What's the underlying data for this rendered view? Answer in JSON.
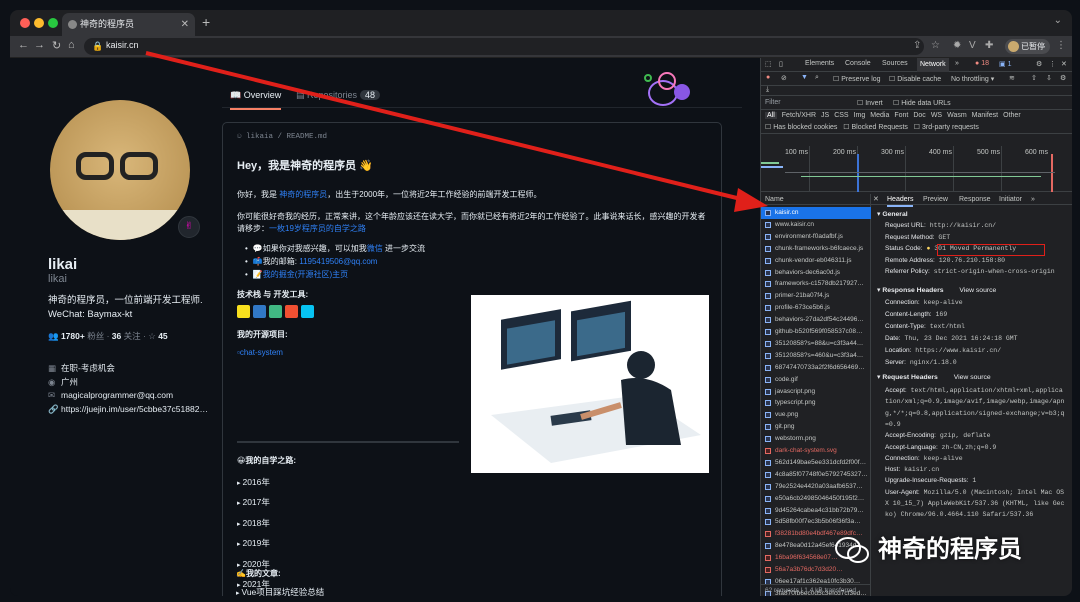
{
  "browser": {
    "tab_title": "神奇的程序员",
    "url": "kaisir.cn",
    "profile_label": "已暂停"
  },
  "profile": {
    "name": "likai",
    "login": "likai",
    "bio_line1": "神奇的程序员，一位前端开发工程师.",
    "bio_line2": "WeChat: Baymax-kt",
    "followers": "1780+",
    "followers_label": "粉丝",
    "following": "36",
    "following_label": "关注",
    "stars": "45",
    "company": "在职-考虑机会",
    "location": "广州",
    "email": "magicalprogrammer@qq.com",
    "website": "https://juejin.im/user/5cbbe37c51882…"
  },
  "tabs": {
    "overview": "Overview",
    "repositories": "Repositories",
    "repo_count": "48"
  },
  "readme": {
    "path": "likaia / README.md",
    "heading": "Hey，我是神奇的程序员 👋",
    "p1_a": "你好，我是",
    "p1_link": "神奇的程序员",
    "p1_b": "，出生于2000年，一位将近2年工作经验的前端开发工程师。",
    "p2": "你可能很好奇我的经历，正常来讲，这个年龄应该还在读大学，而你就已经有将近2年的工作经验了。此事说来话长，感兴趣的开发者请移步：",
    "p2_link": "一枚19岁程序员的自学之路",
    "li1_a": "💬如果你对我感兴趣，可以加我",
    "li1_link": "微信",
    "li1_b": "进一步交流",
    "li2_a": "📫我的邮箱: ",
    "li2_link": "1195419506@qq.com",
    "li3_link": "我的掘金(开源社区)主页",
    "tech_title": "技术栈 与 开发工具:",
    "opensource_title": "我的开源项目:",
    "img_alt": "chat-system",
    "selflearn_title": "😀我的自学之路:",
    "years": [
      "2016年",
      "2017年",
      "2018年",
      "2019年",
      "2020年",
      "2021年"
    ],
    "articles_title": "✍️我的文章:",
    "article1": "Vue项目踩坑经验总结"
  },
  "devtools": {
    "tabs": [
      "Elements",
      "Console",
      "Sources",
      "Network"
    ],
    "errors": "18",
    "messages": "1",
    "preserve_log": "Preserve log",
    "disable_cache": "Disable cache",
    "throttle": "No throttling",
    "filter_placeholder": "Filter",
    "invert": "Invert",
    "hide_data_urls": "Hide data URLs",
    "types": [
      "All",
      "Fetch/XHR",
      "JS",
      "CSS",
      "Img",
      "Media",
      "Font",
      "Doc",
      "WS",
      "Wasm",
      "Manifest",
      "Other"
    ],
    "blocked_cookies": "Has blocked cookies",
    "blocked_requests": "Blocked Requests",
    "third_party": "3rd-party requests",
    "timeline": [
      "100 ms",
      "200 ms",
      "300 ms",
      "400 ms",
      "500 ms",
      "600 ms"
    ],
    "name_header": "Name",
    "requests": [
      {
        "name": "kaisir.cn",
        "sel": true
      },
      {
        "name": "www.kaisir.cn"
      },
      {
        "name": "environment-f0adafbf.js"
      },
      {
        "name": "chunk-frameworks-b6fcaece.js"
      },
      {
        "name": "chunk-vendor-eb046311.js"
      },
      {
        "name": "behaviors-dec6ac0d.js"
      },
      {
        "name": "frameworks-c1578db217927…"
      },
      {
        "name": "primer-21ba07f4.js"
      },
      {
        "name": "profile-673ce5b6.js"
      },
      {
        "name": "behaviors-27da2df54c24496…"
      },
      {
        "name": "github-b520f569f058537c08…"
      },
      {
        "name": "35120858?s=88&u=c3f3a44…"
      },
      {
        "name": "35120858?s=460&u=c3f3a4…"
      },
      {
        "name": "68747470733a2f2f6d656469…"
      },
      {
        "name": "code.gif"
      },
      {
        "name": "javascript.png"
      },
      {
        "name": "typescript.png"
      },
      {
        "name": "vue.png"
      },
      {
        "name": "git.png"
      },
      {
        "name": "webstorm.png"
      },
      {
        "name": "dark-chat-system.svg",
        "red": true
      },
      {
        "name": "562d149bae5ee331dcfd2f00f…"
      },
      {
        "name": "4c8a85f07748f0e5792745327…"
      },
      {
        "name": "79e2524e4420a03aafb6537…"
      },
      {
        "name": "e50a6cb24985046450f195f2…"
      },
      {
        "name": "9d45264cabea4c31bb72b79…"
      },
      {
        "name": "5d58fb00f7ec3b5b06f36f3a…"
      },
      {
        "name": "f38281bd80e4bdf467e89dfc…",
        "red": true
      },
      {
        "name": "8e478ea0d12a45ef641934d…"
      },
      {
        "name": "16ba96f634568e07…",
        "red": true
      },
      {
        "name": "56a7a3b76dc7d3d20…",
        "red": true
      },
      {
        "name": "06ee17af1c362ea10fc3b30…"
      },
      {
        "name": "3fa870fb6ec0d5c3efcd7cf3ed…"
      }
    ],
    "footer": "62 requests  |  1.4 kB transferred",
    "detail_tabs": [
      "Headers",
      "Preview",
      "Response",
      "Initiator"
    ],
    "general_title": "General",
    "general": [
      {
        "k": "Request URL:",
        "v": "http://kaisir.cn/"
      },
      {
        "k": "Request Method:",
        "v": "GET"
      },
      {
        "k": "Status Code:",
        "v": "301 Moved Permanently"
      },
      {
        "k": "Remote Address:",
        "v": "120.76.210.158:80"
      },
      {
        "k": "Referrer Policy:",
        "v": "strict-origin-when-cross-origin"
      }
    ],
    "response_title": "Response Headers",
    "view_source": "View source",
    "response": [
      {
        "k": "Connection:",
        "v": "keep-alive"
      },
      {
        "k": "Content-Length:",
        "v": "169"
      },
      {
        "k": "Content-Type:",
        "v": "text/html"
      },
      {
        "k": "Date:",
        "v": "Thu, 23 Dec 2021 16:24:18 GMT"
      },
      {
        "k": "Location:",
        "v": "https://www.kaisir.cn/"
      },
      {
        "k": "Server:",
        "v": "nginx/1.18.0"
      }
    ],
    "request_title": "Request Headers",
    "request": [
      {
        "k": "Accept:",
        "v": "text/html,application/xhtml+xml,applica"
      },
      {
        "k": "",
        "v": "tion/xml;q=0.9,image/avif,image/webp,image/apn"
      },
      {
        "k": "",
        "v": "g,*/*;q=0.8,application/signed-exchange;v=b3;q"
      },
      {
        "k": "",
        "v": "=0.9"
      },
      {
        "k": "Accept-Encoding:",
        "v": "gzip, deflate"
      },
      {
        "k": "Accept-Language:",
        "v": "zh-CN,zh;q=0.9"
      },
      {
        "k": "Connection:",
        "v": "keep-alive"
      },
      {
        "k": "Host:",
        "v": "kaisir.cn"
      },
      {
        "k": "Upgrade-Insecure-Requests:",
        "v": "1"
      },
      {
        "k": "User-Agent:",
        "v": "Mozilla/5.0 (Macintosh; Intel Mac OS"
      },
      {
        "k": "",
        "v": "X 10_15_7) AppleWebKit/537.36 (KHTML, like Gec"
      },
      {
        "k": "",
        "v": "ko) Chrome/96.0.4664.110 Safari/537.36"
      }
    ]
  },
  "watermark": "神奇的程序员",
  "colors": {
    "accent": "#2f81f7",
    "arrow": "#e0201a",
    "selected": "#1a73e8"
  }
}
